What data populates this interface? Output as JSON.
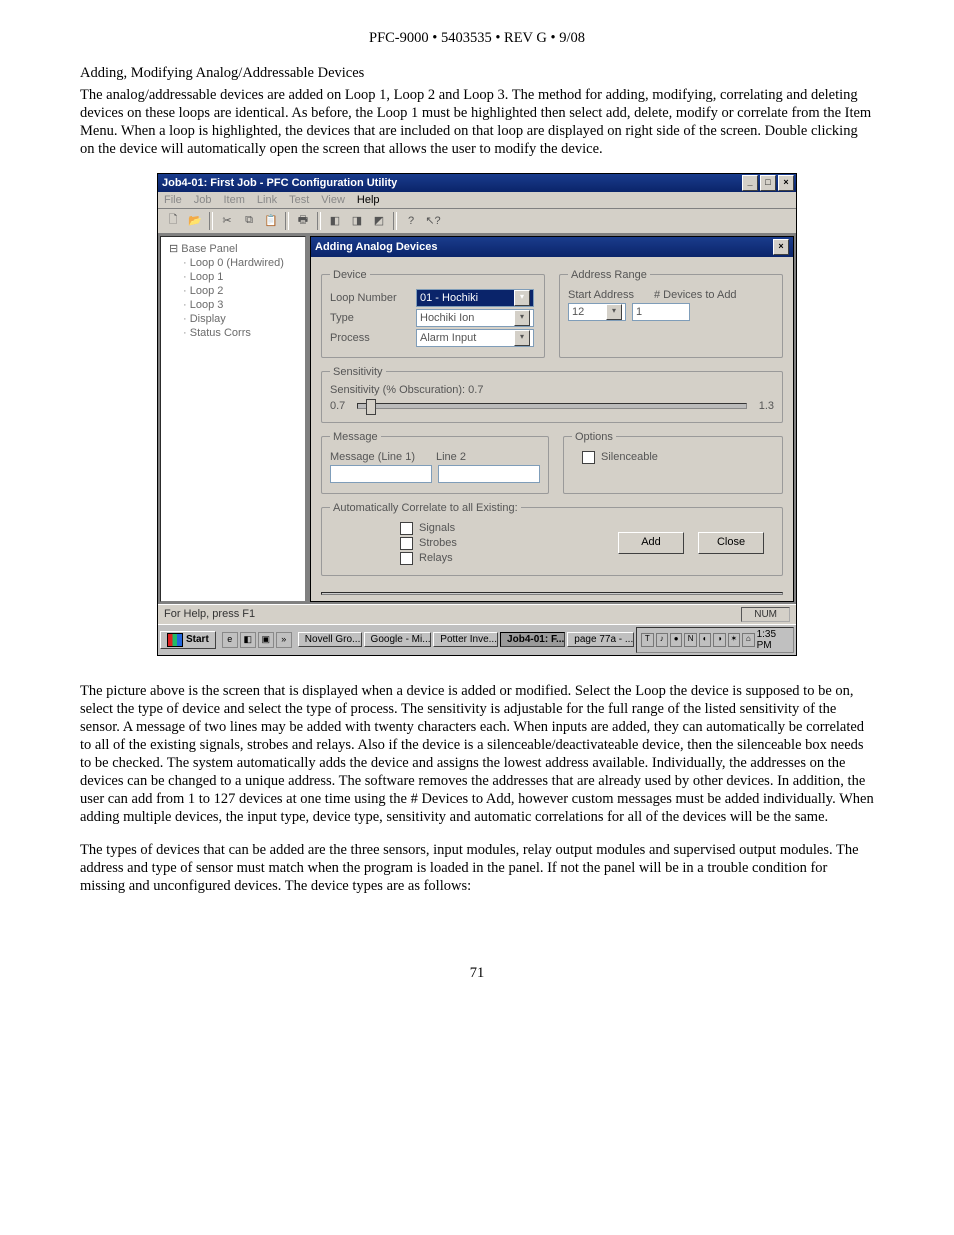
{
  "doc": {
    "header": "PFC-9000 • 5403535 • REV G • 9/08",
    "subheading": "Adding, Modifying Analog/Addressable Devices",
    "para_intro": "The analog/addressable devices are added on Loop 1, Loop 2 and Loop 3. The method for adding, modifying, correlating and deleting devices on these loops are identical. As before, the Loop 1 must be highlighted then select add, delete, modify or correlate from the Item Menu. When a loop is  highlighted, the devices that are included on that loop are displayed on right side of the screen. Double clicking on the device will automatically open the screen that allows the user to modify the device.",
    "para_body1": "The picture above is the screen that is displayed when a device is added or modified. Select the Loop the device is supposed to be on, select the type of device and select the type of process. The sensitivity is adjustable for the full range of the listed sensitivity of the sensor. A message of two lines may be added with twenty characters each. When inputs are added, they can automatically be correlated to all of the existing signals, strobes and relays. Also if the device is a silenceable/deactivateable device, then the silenceable box needs to be checked. The system automatically adds the device and assigns the lowest address available. Individually, the addresses on the devices can be changed to a unique address. The software removes the addresses that are already used by other devices. In addition, the user can add from 1 to 127 devices at one time using the # Devices to Add, however custom messages must be added individually.  When adding multiple devices, the input type, device type, sensitivity and automatic correlations for all of the devices will be the same.",
    "para_body2": "The types of devices that can be added are the three sensors, input modules, relay output modules and supervised output modules. The address and type of sensor must match when the program is loaded in the panel. If not the panel will be in a trouble condition for missing and unconfigured devices. The device types are as follows:",
    "page_number": "71"
  },
  "app": {
    "title": "Job4-01: First Job - PFC Configuration Utility",
    "menus": [
      "File",
      "Job",
      "Item",
      "Link",
      "Test",
      "View",
      "Help"
    ],
    "tree": {
      "root": "Base Panel",
      "items": [
        "Loop 0  (Hardwired)",
        "Loop 1",
        "Loop 2",
        "Loop 3",
        "Display",
        "Status Corrs"
      ]
    },
    "dialog": {
      "title": "Adding Analog Devices",
      "device_legend": "Device",
      "loop_label": "Loop Number",
      "loop_value": "01 - Hochiki",
      "type_label": "Type",
      "type_value": "Hochiki Ion",
      "process_label": "Process",
      "process_value": "Alarm Input",
      "addr_legend": "Address Range",
      "start_addr_label": "Start Address",
      "num_dev_label": "# Devices to Add",
      "start_addr_value": "12",
      "num_dev_value": "1",
      "sens_legend": "Sensitivity",
      "sens_text": "Sensitivity (% Obscuration):  0.7",
      "sens_min": "0.7",
      "sens_max": "1.3",
      "msg_legend": "Message",
      "msg_line1_label": "Message (Line 1)",
      "msg_line2_label": "Line 2",
      "opts_legend": "Options",
      "silenceable_label": "Silenceable",
      "auto_legend": "Automatically Correlate to all Existing:",
      "auto_signals": "Signals",
      "auto_strobes": "Strobes",
      "auto_relays": "Relays",
      "btn_add": "Add",
      "btn_close": "Close"
    },
    "status": {
      "help": "For Help, press F1",
      "indicator": "NUM"
    },
    "taskbar": {
      "start": "Start",
      "tasks": [
        "Novell Gro...",
        "Google - Mi...",
        "Potter Inve...",
        "Job4-01: F...",
        "page 77a - ..."
      ],
      "active_index": 3,
      "clock": "1:35 PM"
    }
  }
}
